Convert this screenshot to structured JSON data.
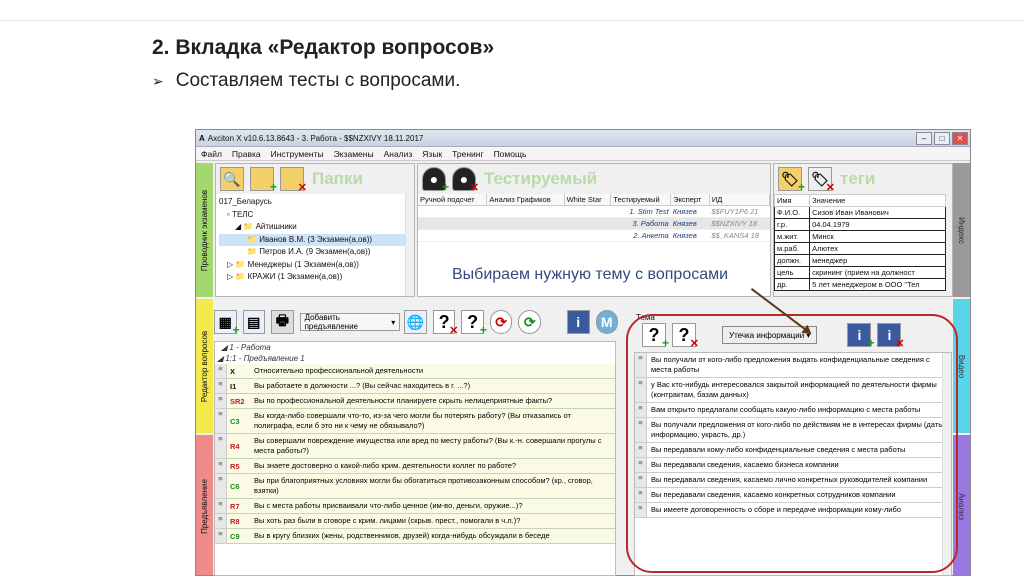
{
  "slide": {
    "title": "2. Вкладка «Редактор вопросов»",
    "bullet": "Составляем тесты с вопросами."
  },
  "window": {
    "title": "Axciton X v10.6.13.8643 - 3. Работа - $$NZXIVY 18.11.2017",
    "menu": [
      "Файл",
      "Правка",
      "Инструменты",
      "Экзамены",
      "Анализ",
      "Язык",
      "Тренинг",
      "Помощь"
    ]
  },
  "side_tabs": {
    "left": [
      "Проводник экзаменов",
      "Редактор вопросов",
      "Предъявление"
    ],
    "right": [
      "Индекс",
      "Видео",
      "Анализ"
    ]
  },
  "folders_panel": {
    "label": "Папки",
    "tree": [
      "017_Беларусь",
      "ТЕЛС",
      "Айтишники",
      "Иванов В.М. (3 Экзамен(а,ов))",
      "Петров И.А. (9 Экзамен(а,ов))",
      "Менеджеры (1 Экзамен(а,ов))",
      "КРАЖИ (1 Экзамен(а,ов))"
    ]
  },
  "subject_panel": {
    "label": "Тестируемый",
    "columns": [
      "Ручной подсчет",
      "Анализ Графиков",
      "White Star",
      "Тестируемый",
      "Эксперт",
      "ИД"
    ],
    "rows": [
      {
        "test": "1. Stim Test",
        "expert": "Князев",
        "id": "$$FUY1P6",
        "n": "21"
      },
      {
        "test": "3. Работа",
        "expert": "Князев",
        "id": "$$NZXIVY",
        "n": "18"
      },
      {
        "test": "2. Анкета",
        "expert": "Князев",
        "id": "$$_KANS4",
        "n": "18"
      }
    ]
  },
  "tags_panel": {
    "label": "теги",
    "columns": [
      "Имя",
      "Значение"
    ],
    "rows": [
      [
        "Ф.И.О.",
        "Сизов Иван Иванович"
      ],
      [
        "г.р.",
        "04.04.1979"
      ],
      [
        "м.жит.",
        "Минск"
      ],
      [
        "м.раб.",
        "Алютех"
      ],
      [
        "должн.",
        "менеджер"
      ],
      [
        "цель",
        "скрининг (прием на должност"
      ],
      [
        "др.",
        "5 лет менеджером в ООО \"Тел"
      ]
    ]
  },
  "annotation": "Выбираем нужную тему с вопросами",
  "question_editor": {
    "add_button": "Добавить предъявление",
    "groups": [
      "1 - Работа",
      "1:1 - Предъявление 1"
    ],
    "questions": [
      {
        "code": "X",
        "color": "#111",
        "text": "Относительно профессиональной деятельности"
      },
      {
        "code": "I1",
        "color": "#111",
        "text": "Вы работаете в должности ...? (Вы сейчас находитесь в г. ...?)"
      },
      {
        "code": "SR2",
        "color": "#c02020",
        "text": "Вы по профессиональной деятельности планируете скрыть нелицеприятные факты?"
      },
      {
        "code": "C3",
        "color": "#1a8a1a",
        "text": "Вы когда-либо совершали что-то, из-за чего могли бы потерять работу? (Вы отказались от полиграфа, если б это ни к чему не обязывало?)"
      },
      {
        "code": "R4",
        "color": "#c02020",
        "text": "Вы совершали повреждение имущества или вред по месту работы? (Вы к.-н. совершали прогулы с места работы?)"
      },
      {
        "code": "R5",
        "color": "#c02020",
        "text": "Вы знаете достоверно о какой-либо крим. деятельности коллег по работе?"
      },
      {
        "code": "C6",
        "color": "#1a8a1a",
        "text": "Вы при благоприятных условиях могли бы обогатиться противозаконным способом? (кр., сговор, взятки)"
      },
      {
        "code": "R7",
        "color": "#c02020",
        "text": "Вы с места работы присваивали что-либо ценное (им-во, деньги, оружие...)?"
      },
      {
        "code": "R8",
        "color": "#c02020",
        "text": "Вы хоть раз были в сговоре с крим. лицами (скрыв. прест., помогали в ч.л.)?"
      },
      {
        "code": "C9",
        "color": "#1a8a1a",
        "text": "Вы в кругу близких (жены, родственников, друзей) когда-нибудь обсуждали в беседе"
      }
    ]
  },
  "topic_panel": {
    "label": "Тема",
    "dropdown": "Утечка информации",
    "items": [
      "Вы получали от кого-либо предложения выдать конфиденциальные сведения с места работы",
      "у Вас кто-нибудь интересовался закрытой информацией по деятельности фирмы (контрактам, базам данных)",
      "Вам открыто предлагали сообщать какую-либо информацию с места работы",
      "Вы получали предложения от кого-либо по действиям не в интересах фирмы (дать информацию, украсть, др.)",
      "Вы передавали кому-либо конфиденциальные сведения с места работы",
      "Вы передавали сведения, касаемо бизнеса компании",
      "Вы передавали сведения, касаемо лично конкретных руководителей компании",
      "Вы передавали сведения, касаемо конкретных сотрудников компании",
      "Вы имеете договоренность о сборе и передаче информации кому-либо"
    ]
  }
}
